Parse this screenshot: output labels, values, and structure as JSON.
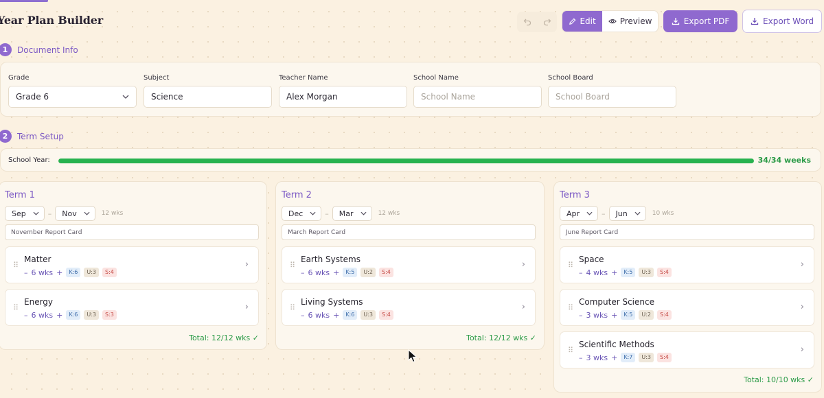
{
  "header": {
    "title": "Year Plan Builder",
    "undo_icon": "undo-icon",
    "redo_icon": "redo-icon",
    "edit_label": "Edit",
    "preview_label": "Preview",
    "export_pdf_label": "Export PDF",
    "export_word_label": "Export Word",
    "active_mode": "Edit"
  },
  "doc_info": {
    "step": "1",
    "heading": "Document Info",
    "grade_label": "Grade",
    "grade_value": "Grade 6",
    "subject_label": "Subject",
    "subject_value": "Science",
    "teacher_label": "Teacher Name",
    "teacher_value": "Alex Morgan",
    "school_label": "School Name",
    "school_placeholder": "School Name",
    "board_label": "School Board",
    "board_placeholder": "School Board"
  },
  "term_setup": {
    "step": "2",
    "heading": "Term Setup",
    "school_year_label": "School Year:",
    "weeks_used": 34,
    "weeks_total": 34,
    "weeks_text": "34/34 weeks"
  },
  "terms": [
    {
      "title": "Term 1",
      "start_month": "Sep",
      "end_month": "Nov",
      "weeks": "12 wks",
      "report": "November Report Card",
      "units": [
        {
          "name": "Matter",
          "weeks": "6 wks",
          "k": "K:6",
          "u": "U:3",
          "s": "S:4"
        },
        {
          "name": "Energy",
          "weeks": "6 wks",
          "k": "K:6",
          "u": "U:3",
          "s": "S:3"
        }
      ],
      "total": "Total: 12/12 wks ✓"
    },
    {
      "title": "Term 2",
      "start_month": "Dec",
      "end_month": "Mar",
      "weeks": "12 wks",
      "report": "March Report Card",
      "units": [
        {
          "name": "Earth Systems",
          "weeks": "6 wks",
          "k": "K:5",
          "u": "U:2",
          "s": "S:4"
        },
        {
          "name": "Living Systems",
          "weeks": "6 wks",
          "k": "K:6",
          "u": "U:3",
          "s": "S:4"
        }
      ],
      "total": "Total: 12/12 wks ✓"
    },
    {
      "title": "Term 3",
      "start_month": "Apr",
      "end_month": "Jun",
      "weeks": "10 wks",
      "report": "June Report Card",
      "units": [
        {
          "name": "Space",
          "weeks": "4 wks",
          "k": "K:5",
          "u": "U:3",
          "s": "S:4"
        },
        {
          "name": "Computer Science",
          "weeks": "3 wks",
          "k": "K:5",
          "u": "U:2",
          "s": "S:4"
        },
        {
          "name": "Scientific Methods",
          "weeks": "3 wks",
          "k": "K:7",
          "u": "U:3",
          "s": "S:4"
        }
      ],
      "total": "Total: 10/10 wks ✓"
    }
  ],
  "colors": {
    "accent": "#8f69cf",
    "success": "#27b24f",
    "background": "#fbf1e1"
  }
}
